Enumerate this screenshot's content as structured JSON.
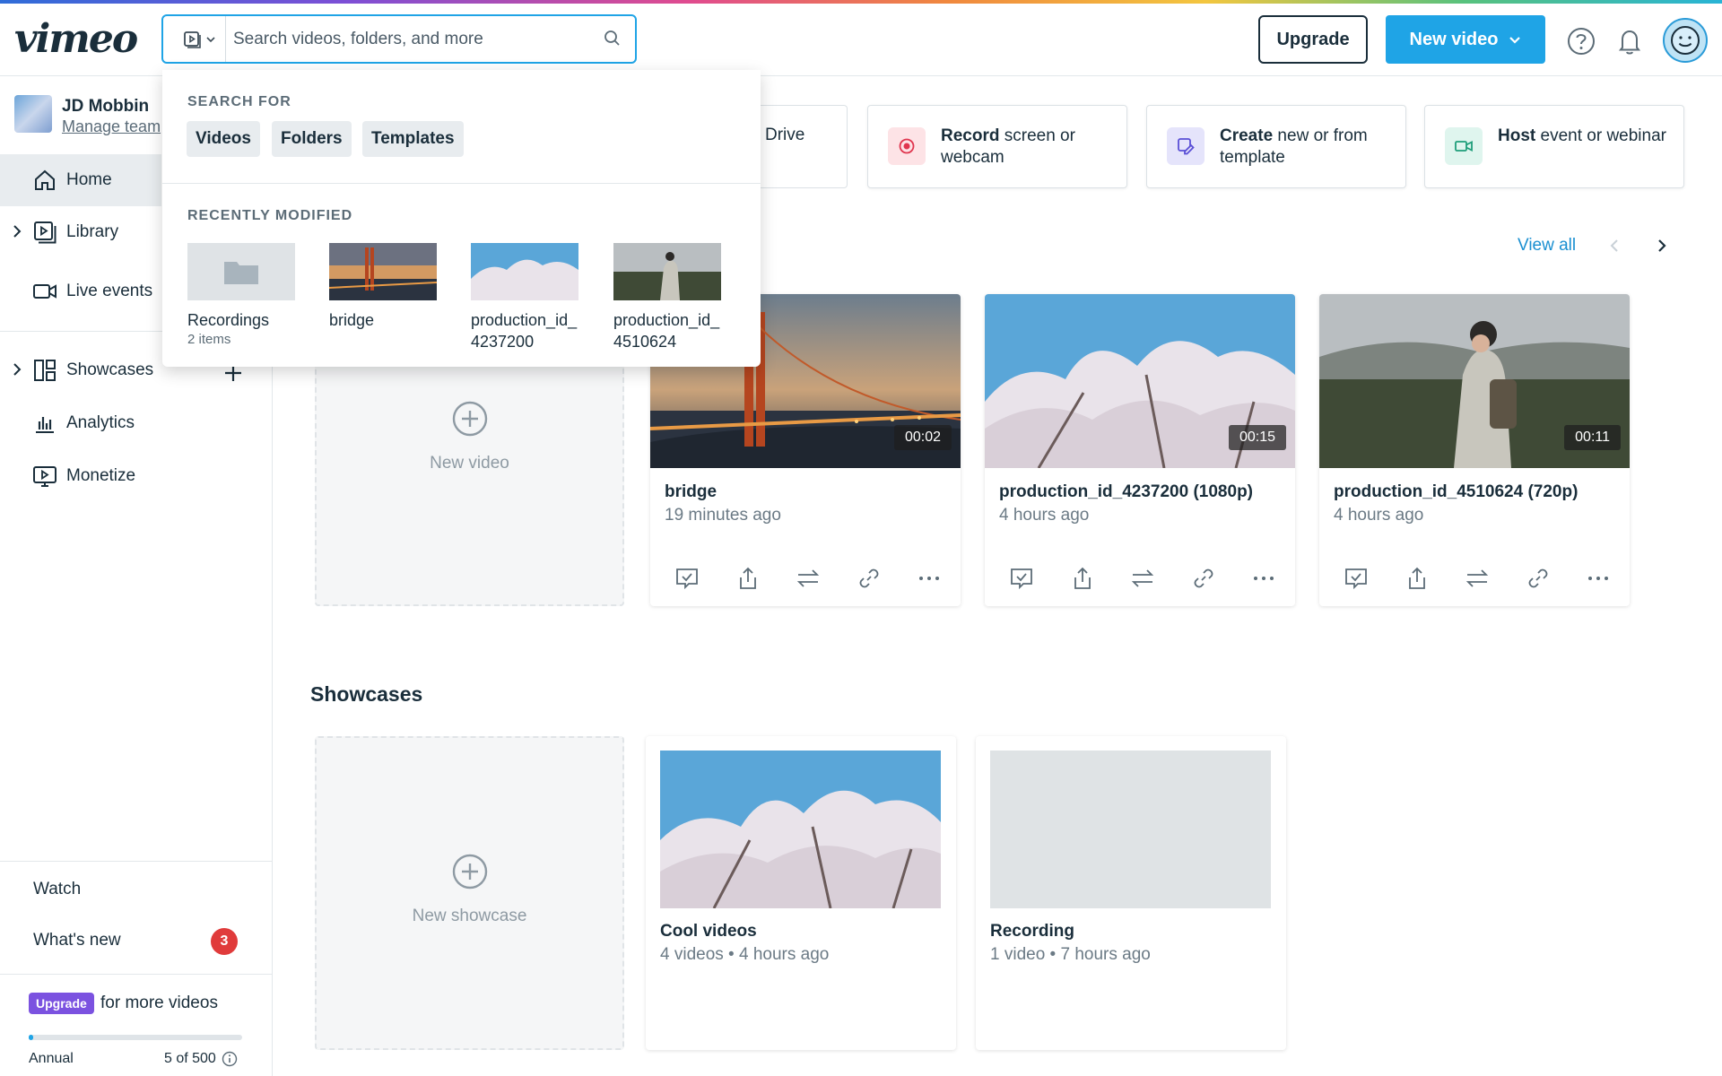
{
  "header": {
    "logo": "vimeo",
    "search_placeholder": "Search videos, folders, and more",
    "upgrade_label": "Upgrade",
    "new_video_label": "New video"
  },
  "search_dropdown": {
    "search_for_heading": "SEARCH FOR",
    "filters": [
      "Videos",
      "Folders",
      "Templates"
    ],
    "recent_heading": "RECENTLY MODIFIED",
    "recent": [
      {
        "label": "Recordings",
        "sub": "2 items"
      },
      {
        "label": "bridge",
        "sub": ""
      },
      {
        "label": "production_id_4237200",
        "sub": ""
      },
      {
        "label": "production_id_4510624",
        "sub": ""
      }
    ]
  },
  "sidebar": {
    "team_name": "JD Mobbin",
    "manage_team": "Manage team",
    "items": [
      {
        "label": "Home"
      },
      {
        "label": "Library"
      },
      {
        "label": "Live events"
      },
      {
        "label": "Showcases"
      },
      {
        "label": "Analytics"
      },
      {
        "label": "Monetize"
      }
    ],
    "watch": "Watch",
    "whats_new": "What's new",
    "whats_new_count": "3",
    "upgrade_pill": "Upgrade",
    "upgrade_text": "for more videos",
    "plan": "Annual",
    "quota": "5 of 500",
    "quota_fraction": 0.01
  },
  "actions": [
    {
      "bold": "Record",
      "rest": " screen or webcam",
      "color": "#fde3e6"
    },
    {
      "bold": "Create",
      "rest": " new or from template",
      "color": "#e5e4fb"
    },
    {
      "bold": "Host",
      "rest": " event or webinar",
      "color": "#dff5ee"
    }
  ],
  "drive_fragment": "Drive",
  "recent_videos": {
    "view_all": "View all",
    "new_video_label": "New video",
    "items": [
      {
        "title": "bridge",
        "time": "19 minutes ago",
        "duration": "00:02"
      },
      {
        "title": "production_id_4237200 (1080p)",
        "time": "4 hours ago",
        "duration": "00:15"
      },
      {
        "title": "production_id_4510624 (720p)",
        "time": "4 hours ago",
        "duration": "00:11"
      }
    ]
  },
  "showcases": {
    "title": "Showcases",
    "new_label": "New showcase",
    "items": [
      {
        "title": "Cool videos",
        "meta": "4 videos  •  4 hours ago"
      },
      {
        "title": "Recording",
        "meta": "1 video  •  7 hours ago"
      }
    ]
  }
}
